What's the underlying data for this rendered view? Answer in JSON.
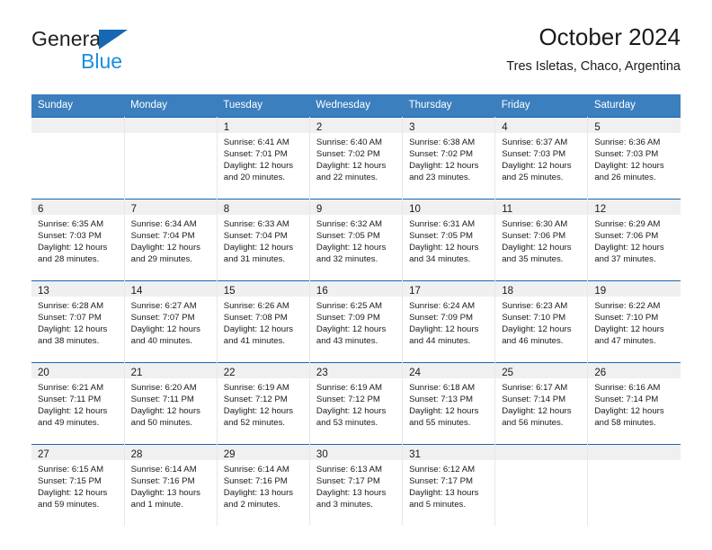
{
  "brand": {
    "name_part1": "General",
    "name_part2": "Blue",
    "triangle_icon": "triangle-icon",
    "accent_dark": "#231f20",
    "accent_blue": "#1a8fdd",
    "triangle_color": "#1668b3"
  },
  "header": {
    "title": "October 2024",
    "subtitle": "Tres Isletas, Chaco, Argentina"
  },
  "colors": {
    "header_row_bg": "#3b7fbe",
    "header_row_text": "#ffffff",
    "daynum_band_bg": "#f0f0f0",
    "week_separator": "#1668b3",
    "cell_bg": "#ffffff"
  },
  "weekdays": [
    "Sunday",
    "Monday",
    "Tuesday",
    "Wednesday",
    "Thursday",
    "Friday",
    "Saturday"
  ],
  "weeks": [
    [
      {
        "day": "",
        "lines": [
          "",
          "",
          "",
          ""
        ]
      },
      {
        "day": "",
        "lines": [
          "",
          "",
          "",
          ""
        ]
      },
      {
        "day": "1",
        "lines": [
          "Sunrise: 6:41 AM",
          "Sunset: 7:01 PM",
          "Daylight: 12 hours",
          "and 20 minutes."
        ]
      },
      {
        "day": "2",
        "lines": [
          "Sunrise: 6:40 AM",
          "Sunset: 7:02 PM",
          "Daylight: 12 hours",
          "and 22 minutes."
        ]
      },
      {
        "day": "3",
        "lines": [
          "Sunrise: 6:38 AM",
          "Sunset: 7:02 PM",
          "Daylight: 12 hours",
          "and 23 minutes."
        ]
      },
      {
        "day": "4",
        "lines": [
          "Sunrise: 6:37 AM",
          "Sunset: 7:03 PM",
          "Daylight: 12 hours",
          "and 25 minutes."
        ]
      },
      {
        "day": "5",
        "lines": [
          "Sunrise: 6:36 AM",
          "Sunset: 7:03 PM",
          "Daylight: 12 hours",
          "and 26 minutes."
        ]
      }
    ],
    [
      {
        "day": "6",
        "lines": [
          "Sunrise: 6:35 AM",
          "Sunset: 7:03 PM",
          "Daylight: 12 hours",
          "and 28 minutes."
        ]
      },
      {
        "day": "7",
        "lines": [
          "Sunrise: 6:34 AM",
          "Sunset: 7:04 PM",
          "Daylight: 12 hours",
          "and 29 minutes."
        ]
      },
      {
        "day": "8",
        "lines": [
          "Sunrise: 6:33 AM",
          "Sunset: 7:04 PM",
          "Daylight: 12 hours",
          "and 31 minutes."
        ]
      },
      {
        "day": "9",
        "lines": [
          "Sunrise: 6:32 AM",
          "Sunset: 7:05 PM",
          "Daylight: 12 hours",
          "and 32 minutes."
        ]
      },
      {
        "day": "10",
        "lines": [
          "Sunrise: 6:31 AM",
          "Sunset: 7:05 PM",
          "Daylight: 12 hours",
          "and 34 minutes."
        ]
      },
      {
        "day": "11",
        "lines": [
          "Sunrise: 6:30 AM",
          "Sunset: 7:06 PM",
          "Daylight: 12 hours",
          "and 35 minutes."
        ]
      },
      {
        "day": "12",
        "lines": [
          "Sunrise: 6:29 AM",
          "Sunset: 7:06 PM",
          "Daylight: 12 hours",
          "and 37 minutes."
        ]
      }
    ],
    [
      {
        "day": "13",
        "lines": [
          "Sunrise: 6:28 AM",
          "Sunset: 7:07 PM",
          "Daylight: 12 hours",
          "and 38 minutes."
        ]
      },
      {
        "day": "14",
        "lines": [
          "Sunrise: 6:27 AM",
          "Sunset: 7:07 PM",
          "Daylight: 12 hours",
          "and 40 minutes."
        ]
      },
      {
        "day": "15",
        "lines": [
          "Sunrise: 6:26 AM",
          "Sunset: 7:08 PM",
          "Daylight: 12 hours",
          "and 41 minutes."
        ]
      },
      {
        "day": "16",
        "lines": [
          "Sunrise: 6:25 AM",
          "Sunset: 7:09 PM",
          "Daylight: 12 hours",
          "and 43 minutes."
        ]
      },
      {
        "day": "17",
        "lines": [
          "Sunrise: 6:24 AM",
          "Sunset: 7:09 PM",
          "Daylight: 12 hours",
          "and 44 minutes."
        ]
      },
      {
        "day": "18",
        "lines": [
          "Sunrise: 6:23 AM",
          "Sunset: 7:10 PM",
          "Daylight: 12 hours",
          "and 46 minutes."
        ]
      },
      {
        "day": "19",
        "lines": [
          "Sunrise: 6:22 AM",
          "Sunset: 7:10 PM",
          "Daylight: 12 hours",
          "and 47 minutes."
        ]
      }
    ],
    [
      {
        "day": "20",
        "lines": [
          "Sunrise: 6:21 AM",
          "Sunset: 7:11 PM",
          "Daylight: 12 hours",
          "and 49 minutes."
        ]
      },
      {
        "day": "21",
        "lines": [
          "Sunrise: 6:20 AM",
          "Sunset: 7:11 PM",
          "Daylight: 12 hours",
          "and 50 minutes."
        ]
      },
      {
        "day": "22",
        "lines": [
          "Sunrise: 6:19 AM",
          "Sunset: 7:12 PM",
          "Daylight: 12 hours",
          "and 52 minutes."
        ]
      },
      {
        "day": "23",
        "lines": [
          "Sunrise: 6:19 AM",
          "Sunset: 7:12 PM",
          "Daylight: 12 hours",
          "and 53 minutes."
        ]
      },
      {
        "day": "24",
        "lines": [
          "Sunrise: 6:18 AM",
          "Sunset: 7:13 PM",
          "Daylight: 12 hours",
          "and 55 minutes."
        ]
      },
      {
        "day": "25",
        "lines": [
          "Sunrise: 6:17 AM",
          "Sunset: 7:14 PM",
          "Daylight: 12 hours",
          "and 56 minutes."
        ]
      },
      {
        "day": "26",
        "lines": [
          "Sunrise: 6:16 AM",
          "Sunset: 7:14 PM",
          "Daylight: 12 hours",
          "and 58 minutes."
        ]
      }
    ],
    [
      {
        "day": "27",
        "lines": [
          "Sunrise: 6:15 AM",
          "Sunset: 7:15 PM",
          "Daylight: 12 hours",
          "and 59 minutes."
        ]
      },
      {
        "day": "28",
        "lines": [
          "Sunrise: 6:14 AM",
          "Sunset: 7:16 PM",
          "Daylight: 13 hours",
          "and 1 minute."
        ]
      },
      {
        "day": "29",
        "lines": [
          "Sunrise: 6:14 AM",
          "Sunset: 7:16 PM",
          "Daylight: 13 hours",
          "and 2 minutes."
        ]
      },
      {
        "day": "30",
        "lines": [
          "Sunrise: 6:13 AM",
          "Sunset: 7:17 PM",
          "Daylight: 13 hours",
          "and 3 minutes."
        ]
      },
      {
        "day": "31",
        "lines": [
          "Sunrise: 6:12 AM",
          "Sunset: 7:17 PM",
          "Daylight: 13 hours",
          "and 5 minutes."
        ]
      },
      {
        "day": "",
        "lines": [
          "",
          "",
          "",
          ""
        ]
      },
      {
        "day": "",
        "lines": [
          "",
          "",
          "",
          ""
        ]
      }
    ]
  ]
}
